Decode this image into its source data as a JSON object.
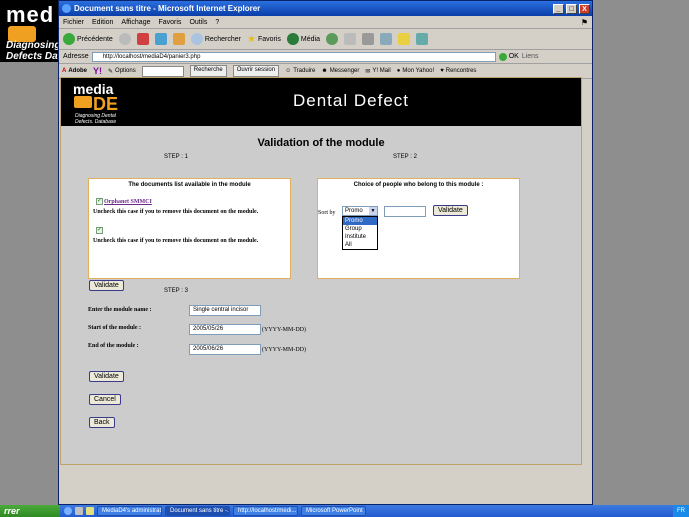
{
  "background": {
    "logo_prefix": "med",
    "logo_suffix": "D",
    "subtitle_1": "Diagnosing",
    "subtitle_2": "Defects Da"
  },
  "window": {
    "title": "Document sans titre - Microsoft Internet Explorer",
    "controls": [
      "_",
      "□",
      "X"
    ]
  },
  "menu": [
    "Fichier",
    "Edition",
    "Affichage",
    "Favoris",
    "Outils",
    "?"
  ],
  "toolbar": {
    "back": "Précédente",
    "search": "Rechercher",
    "favorites": "Favoris",
    "media": "Média"
  },
  "address": {
    "label": "Adresse",
    "url": "http://localhost/mediaD4/panier3.php",
    "go": "OK",
    "links": "Liens"
  },
  "links_bar": {
    "adobe": "Adobe",
    "options": "Options",
    "search_btn": "Recherche",
    "session": "Ouvrir session",
    "translate": "Traduire",
    "messenger": "Messenger",
    "mail": "Y! Mail",
    "myyahoo": "Mon Yahoo!",
    "meet": "Rencontres"
  },
  "banner": {
    "logo_top": "media",
    "logo_letters": "DE",
    "tagline_1": "Diagnosing Dental",
    "tagline_2": "Defects. Database",
    "title": "Dental Defect"
  },
  "page": {
    "heading": "Validation of the module",
    "step1": "STEP : 1",
    "step2": "STEP : 2",
    "step3": "STEP : 3",
    "docs_panel": {
      "title": "The documents list available in the module",
      "doc1_link": "Orphanet SMMCI",
      "hint": "Uncheck this case if you to remove this document on the module."
    },
    "people_panel": {
      "title": "Choice of people who belong to this module :",
      "sort_label": "Sort by",
      "selected": "Promo",
      "options": [
        "Promo",
        "Group",
        "Institute",
        "All"
      ],
      "validate": "Validate"
    },
    "validate_step1": "Validate",
    "module_name_label": "Enter the module name :",
    "module_name_value": "Single central incisor",
    "start_label": "Start of the module :",
    "start_value": "2005/05/26",
    "end_label": "End of the module :",
    "end_value": "2005/06/26",
    "date_format": "(YYYY-MM-DD)",
    "validate_btn": "Validate",
    "cancel_btn": "Cancel",
    "back_btn": "Back"
  },
  "taskbar": {
    "start": "rrer",
    "tasks": [
      "MediaD4's administrat...",
      "Document sans titre -...",
      "http://localhost/medi...",
      "Microsoft PowerPoint ..."
    ],
    "tray": "FR"
  }
}
